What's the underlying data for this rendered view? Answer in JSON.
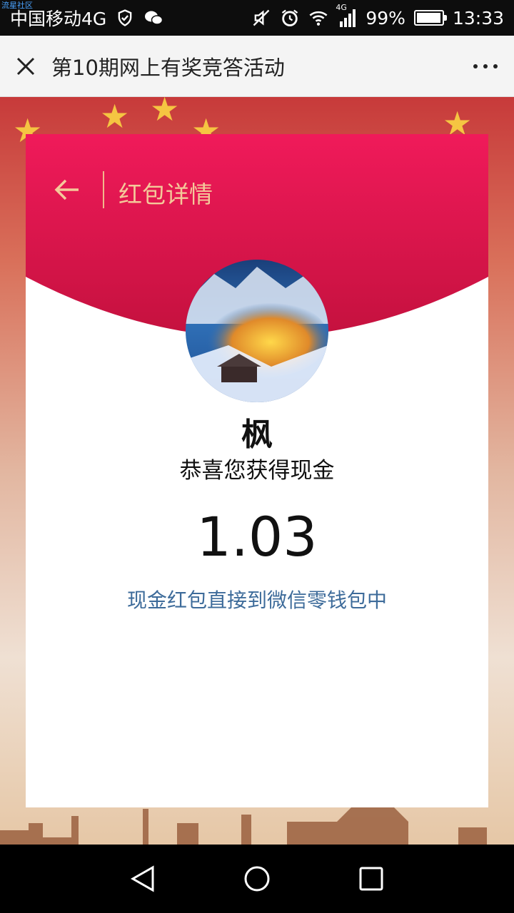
{
  "status_bar": {
    "watermark": "流星社区",
    "carrier": "中国移动4G",
    "network_small": "4G",
    "battery": "99%",
    "time": "13:33"
  },
  "title_bar": {
    "title": "第10期网上有奖竞答活动"
  },
  "card": {
    "header_title": "红包详情",
    "name": "枫",
    "congrats": "恭喜您获得现金",
    "amount": "1.03",
    "note": "现金红包直接到微信零钱包中"
  },
  "colors": {
    "header_red": "#e0195a",
    "header_text": "#f4c99a",
    "note_blue": "#3d6b9a"
  },
  "icons": {
    "close": "close-icon",
    "more": "more-icon",
    "back": "back-arrow-icon",
    "nav_back": "nav-back-icon",
    "nav_home": "nav-home-icon",
    "nav_recent": "nav-recent-icon"
  }
}
